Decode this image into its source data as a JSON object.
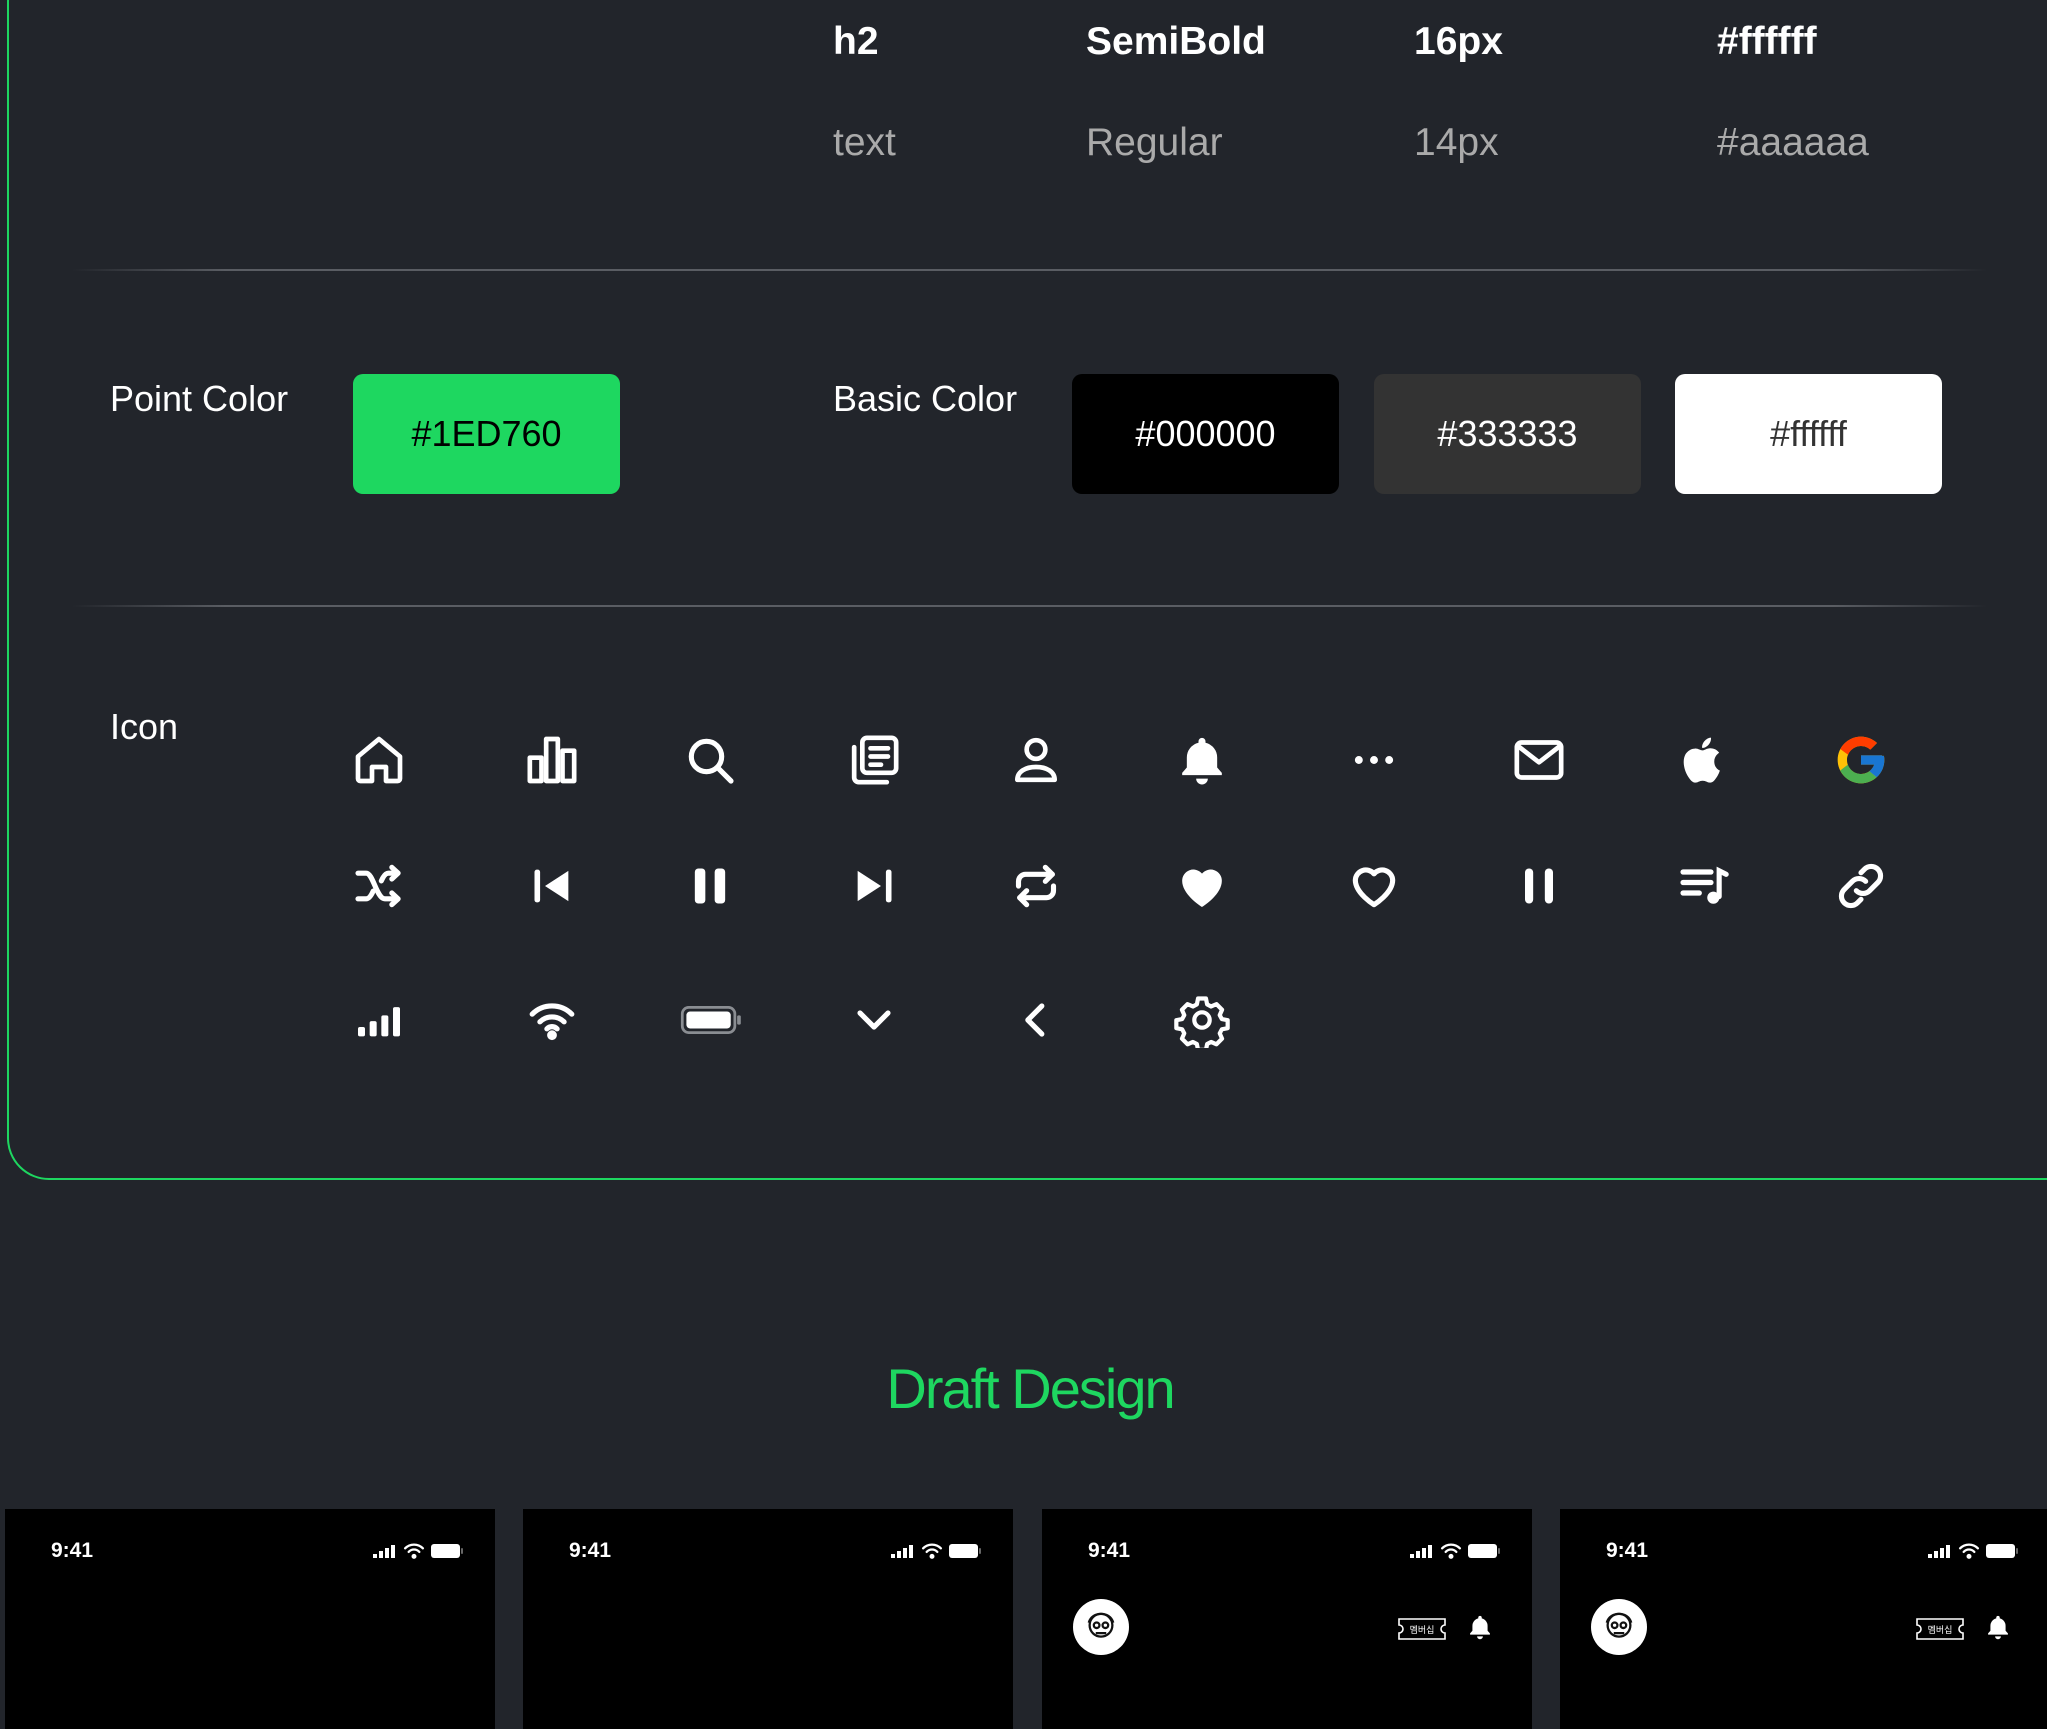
{
  "typography": {
    "rows": [
      {
        "style": "h2",
        "weight": "SemiBold",
        "size": "16px",
        "color": "#ffffff"
      },
      {
        "style": "text",
        "weight": "Regular",
        "size": "14px",
        "color": "#aaaaaa"
      }
    ]
  },
  "colors": {
    "point_label": "Point Color",
    "point": {
      "label": "#1ED760",
      "hex": "#1ED760"
    },
    "basic_label": "Basic Color",
    "basic": [
      {
        "label": "#000000",
        "hex": "#000000"
      },
      {
        "label": "#333333",
        "hex": "#333333"
      },
      {
        "label": "#ffffff",
        "hex": "#ffffff"
      }
    ]
  },
  "icons": {
    "label": "Icon",
    "row1": [
      "home-icon",
      "chart-icon",
      "search-icon",
      "library-icon",
      "user-icon",
      "bell-icon",
      "more-icon",
      "mail-icon",
      "apple-icon",
      "google-icon"
    ],
    "row2": [
      "shuffle-icon",
      "previous-icon",
      "pause-icon",
      "next-icon",
      "repeat-icon",
      "heart-filled-icon",
      "heart-outline-icon",
      "pause-thin-icon",
      "playlist-icon",
      "link-icon"
    ],
    "row3": [
      "signal-icon",
      "wifi-icon",
      "battery-icon",
      "chevron-down-icon",
      "chevron-left-icon",
      "settings-icon"
    ]
  },
  "draft": {
    "title": "Draft Design",
    "phones": [
      {
        "time": "9:41"
      },
      {
        "time": "9:41"
      },
      {
        "time": "9:41",
        "ticket": "멤버십"
      },
      {
        "time": "9:41",
        "ticket": "멤버십"
      }
    ]
  }
}
